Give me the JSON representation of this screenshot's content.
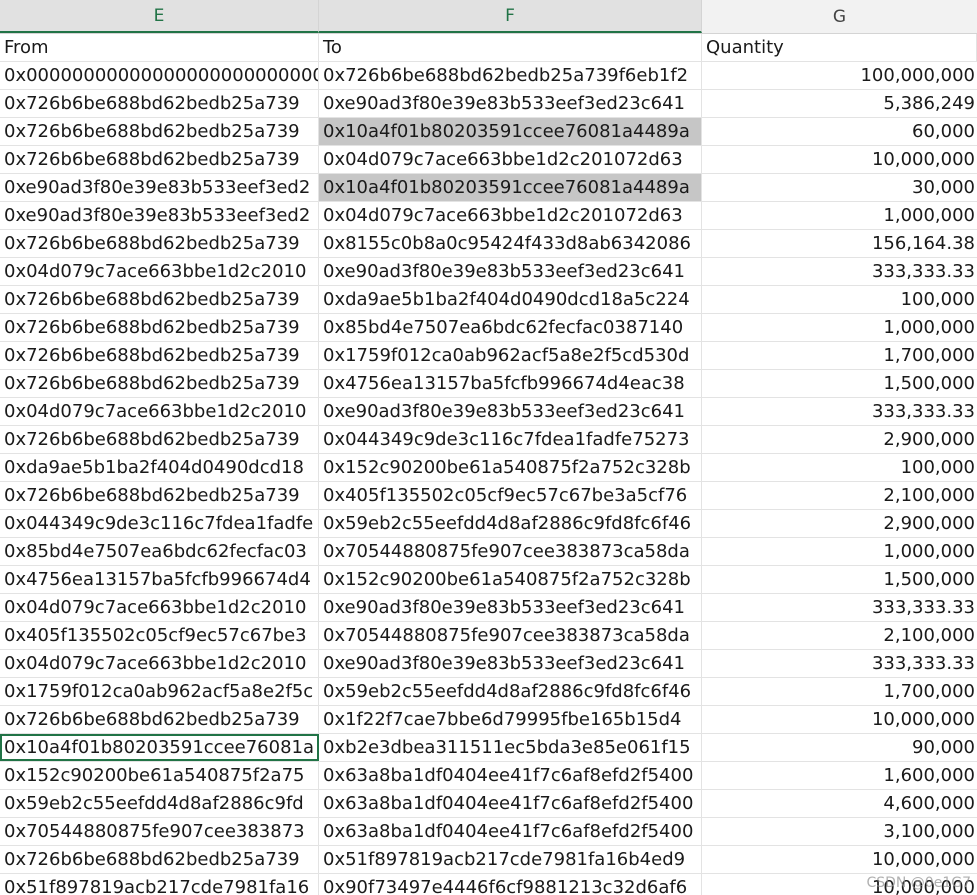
{
  "columns": {
    "e": "E",
    "f": "F",
    "g": "G"
  },
  "headers": {
    "from": "From",
    "to": "To",
    "quantity": "Quantity"
  },
  "rows": [
    {
      "from": "0x0000000000000000000000000000",
      "to": "0x726b6be688bd62bedb25a739f6eb1f2",
      "qty": "100,000,000"
    },
    {
      "from": "0x726b6be688bd62bedb25a739",
      "to": "0xe90ad3f80e39e83b533eef3ed23c641",
      "qty": "5,386,249"
    },
    {
      "from": "0x726b6be688bd62bedb25a739",
      "to": "0x10a4f01b80203591ccee76081a4489a",
      "qty": "60,000"
    },
    {
      "from": "0x726b6be688bd62bedb25a739",
      "to": "0x04d079c7ace663bbe1d2c201072d63",
      "qty": "10,000,000"
    },
    {
      "from": "0xe90ad3f80e39e83b533eef3ed2",
      "to": "0x10a4f01b80203591ccee76081a4489a",
      "qty": "30,000"
    },
    {
      "from": "0xe90ad3f80e39e83b533eef3ed2",
      "to": "0x04d079c7ace663bbe1d2c201072d63",
      "qty": "1,000,000"
    },
    {
      "from": "0x726b6be688bd62bedb25a739",
      "to": "0x8155c0b8a0c95424f433d8ab6342086",
      "qty": "156,164.38"
    },
    {
      "from": "0x04d079c7ace663bbe1d2c2010",
      "to": "0xe90ad3f80e39e83b533eef3ed23c641",
      "qty": "333,333.33"
    },
    {
      "from": "0x726b6be688bd62bedb25a739",
      "to": "0xda9ae5b1ba2f404d0490dcd18a5c224",
      "qty": "100,000"
    },
    {
      "from": "0x726b6be688bd62bedb25a739",
      "to": "0x85bd4e7507ea6bdc62fecfac0387140",
      "qty": "1,000,000"
    },
    {
      "from": "0x726b6be688bd62bedb25a739",
      "to": "0x1759f012ca0ab962acf5a8e2f5cd530d",
      "qty": "1,700,000"
    },
    {
      "from": "0x726b6be688bd62bedb25a739",
      "to": "0x4756ea13157ba5fcfb996674d4eac38",
      "qty": "1,500,000"
    },
    {
      "from": "0x04d079c7ace663bbe1d2c2010",
      "to": "0xe90ad3f80e39e83b533eef3ed23c641",
      "qty": "333,333.33"
    },
    {
      "from": "0x726b6be688bd62bedb25a739",
      "to": "0x044349c9de3c116c7fdea1fadfe75273",
      "qty": "2,900,000"
    },
    {
      "from": "0xda9ae5b1ba2f404d0490dcd18",
      "to": "0x152c90200be61a540875f2a752c328b",
      "qty": "100,000"
    },
    {
      "from": "0x726b6be688bd62bedb25a739",
      "to": "0x405f135502c05cf9ec57c67be3a5cf76",
      "qty": "2,100,000"
    },
    {
      "from": "0x044349c9de3c116c7fdea1fadfe",
      "to": "0x59eb2c55eefdd4d8af2886c9fd8fc6f46",
      "qty": "2,900,000"
    },
    {
      "from": "0x85bd4e7507ea6bdc62fecfac03",
      "to": "0x70544880875fe907cee383873ca58da",
      "qty": "1,000,000"
    },
    {
      "from": "0x4756ea13157ba5fcfb996674d4",
      "to": "0x152c90200be61a540875f2a752c328b",
      "qty": "1,500,000"
    },
    {
      "from": "0x04d079c7ace663bbe1d2c2010",
      "to": "0xe90ad3f80e39e83b533eef3ed23c641",
      "qty": "333,333.33"
    },
    {
      "from": "0x405f135502c05cf9ec57c67be3",
      "to": "0x70544880875fe907cee383873ca58da",
      "qty": "2,100,000"
    },
    {
      "from": "0x04d079c7ace663bbe1d2c2010",
      "to": "0xe90ad3f80e39e83b533eef3ed23c641",
      "qty": "333,333.33"
    },
    {
      "from": "0x1759f012ca0ab962acf5a8e2f5c",
      "to": "0x59eb2c55eefdd4d8af2886c9fd8fc6f46",
      "qty": "1,700,000"
    },
    {
      "from": "0x726b6be688bd62bedb25a739",
      "to": "0x1f22f7cae7bbe6d79995fbe165b15d4",
      "qty": "10,000,000"
    },
    {
      "from": "0x10a4f01b80203591ccee76081a",
      "to": "0xb2e3dbea311511ec5bda3e85e061f15",
      "qty": "90,000"
    },
    {
      "from": "0x152c90200be61a540875f2a75",
      "to": "0x63a8ba1df0404ee41f7c6af8efd2f5400",
      "qty": "1,600,000"
    },
    {
      "from": "0x59eb2c55eefdd4d8af2886c9fd",
      "to": "0x63a8ba1df0404ee41f7c6af8efd2f5400",
      "qty": "4,600,000"
    },
    {
      "from": "0x70544880875fe907cee383873",
      "to": "0x63a8ba1df0404ee41f7c6af8efd2f5400",
      "qty": "3,100,000"
    },
    {
      "from": "0x726b6be688bd62bedb25a739",
      "to": "0x51f897819acb217cde7981fa16b4ed9",
      "qty": "10,000,000"
    },
    {
      "from": "0x51f897819acb217cde7981fa16",
      "to": "0x90f73497e4446f6cf9881213c32d6af6",
      "qty": "10,000,000"
    }
  ],
  "highlight_rows": [
    2,
    4
  ],
  "active_row": 24,
  "colors": {
    "selected_header": "#217346",
    "highlight_fill": "#c6c6c6"
  },
  "watermark": "CSDN @0e1G7"
}
